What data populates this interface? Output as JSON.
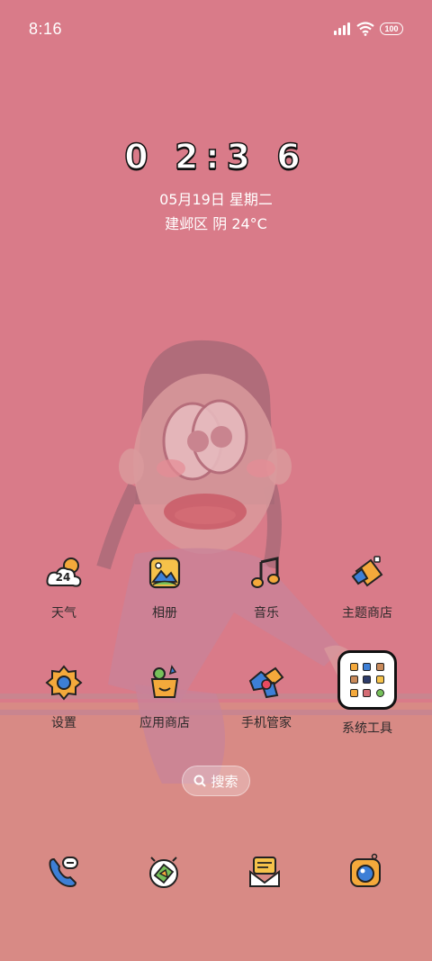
{
  "status_bar": {
    "time": "8:16",
    "battery": "100"
  },
  "clock_widget": {
    "time": "0 2:3 6",
    "date": "05月19日 星期二",
    "weather": "建邺区 阴 24°C"
  },
  "apps_row1": [
    {
      "label": "天气",
      "icon": "weather-icon",
      "badge": "24"
    },
    {
      "label": "相册",
      "icon": "gallery-icon"
    },
    {
      "label": "音乐",
      "icon": "music-icon"
    },
    {
      "label": "主题商店",
      "icon": "theme-store-icon"
    }
  ],
  "apps_row2": [
    {
      "label": "设置",
      "icon": "settings-icon"
    },
    {
      "label": "应用商店",
      "icon": "app-store-icon"
    },
    {
      "label": "手机管家",
      "icon": "phone-manager-icon"
    },
    {
      "label": "系统工具",
      "icon": "system-tools-folder"
    }
  ],
  "search": {
    "label": "搜索"
  },
  "dock": [
    {
      "icon": "phone-icon"
    },
    {
      "icon": "browser-icon"
    },
    {
      "icon": "messages-icon"
    },
    {
      "icon": "camera-icon"
    }
  ],
  "colors": {
    "wallpaper_top": "#d97b89",
    "wallpaper_bottom": "#d88a85",
    "figure": "#b8707e",
    "label_text": "#2e2a2b"
  }
}
